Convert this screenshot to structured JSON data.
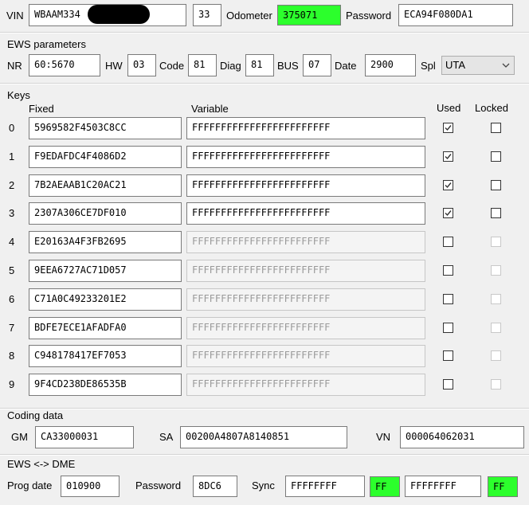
{
  "top": {
    "vin_label": "VIN",
    "vin_value": "WBAAM334",
    "field2_value": "33",
    "odometer_label": "Odometer",
    "odometer_value": "375071",
    "password_label": "Password",
    "password_value": "ECA94F080DA1",
    "odometer_color": "#2cff2c"
  },
  "ews": {
    "title": "EWS parameters",
    "nr_label": "NR",
    "nr_value": "60:5670",
    "hw_label": "HW",
    "hw_value": "03",
    "code_label": "Code",
    "code_value": "81",
    "diag_label": "Diag",
    "diag_value": "81",
    "bus_label": "BUS",
    "bus_value": "07",
    "date_label": "Date",
    "date_value": "2900",
    "spl_label": "Spl",
    "spl_value": "UTA"
  },
  "keys": {
    "title": "Keys",
    "col_fixed": "Fixed",
    "col_variable": "Variable",
    "col_used": "Used",
    "col_locked": "Locked",
    "rows": [
      {
        "index": "0",
        "fixed": "5969582F4503C8CC",
        "variable": "FFFFFFFFFFFFFFFFFFFFFFFF",
        "used": true,
        "locked": false,
        "enabled": true
      },
      {
        "index": "1",
        "fixed": "F9EDAFDC4F4086D2",
        "variable": "FFFFFFFFFFFFFFFFFFFFFFFF",
        "used": true,
        "locked": false,
        "enabled": true
      },
      {
        "index": "2",
        "fixed": "7B2AEAAB1C20AC21",
        "variable": "FFFFFFFFFFFFFFFFFFFFFFFF",
        "used": true,
        "locked": false,
        "enabled": true
      },
      {
        "index": "3",
        "fixed": "2307A306CE7DF010",
        "variable": "FFFFFFFFFFFFFFFFFFFFFFFF",
        "used": true,
        "locked": false,
        "enabled": true
      },
      {
        "index": "4",
        "fixed": "E20163A4F3FB2695",
        "variable": "FFFFFFFFFFFFFFFFFFFFFFFF",
        "used": false,
        "locked": false,
        "enabled": false
      },
      {
        "index": "5",
        "fixed": "9EEA6727AC71D057",
        "variable": "FFFFFFFFFFFFFFFFFFFFFFFF",
        "used": false,
        "locked": false,
        "enabled": false
      },
      {
        "index": "6",
        "fixed": "C71A0C49233201E2",
        "variable": "FFFFFFFFFFFFFFFFFFFFFFFF",
        "used": false,
        "locked": false,
        "enabled": false
      },
      {
        "index": "7",
        "fixed": "BDFE7ECE1AFADFA0",
        "variable": "FFFFFFFFFFFFFFFFFFFFFFFF",
        "used": false,
        "locked": false,
        "enabled": false
      },
      {
        "index": "8",
        "fixed": "C948178417EF7053",
        "variable": "FFFFFFFFFFFFFFFFFFFFFFFF",
        "used": false,
        "locked": false,
        "enabled": false
      },
      {
        "index": "9",
        "fixed": "9F4CD238DE86535B",
        "variable": "FFFFFFFFFFFFFFFFFFFFFFFF",
        "used": false,
        "locked": false,
        "enabled": false
      }
    ]
  },
  "coding": {
    "title": "Coding data",
    "gm_label": "GM",
    "gm_value": "CA33000031",
    "sa_label": "SA",
    "sa_value": "00200A4807A8140851",
    "vn_label": "VN",
    "vn_value": "000064062031"
  },
  "dme": {
    "title": "EWS <-> DME",
    "prog_date_label": "Prog date",
    "prog_date_value": "010900",
    "password_label": "Password",
    "password_value": "8DC6",
    "sync_label": "Sync",
    "sync1_value": "FFFFFFFF",
    "sync1_status": "FF",
    "sync2_value": "FFFFFFFF",
    "sync2_status": "FF",
    "status_color": "#2cff2c"
  }
}
